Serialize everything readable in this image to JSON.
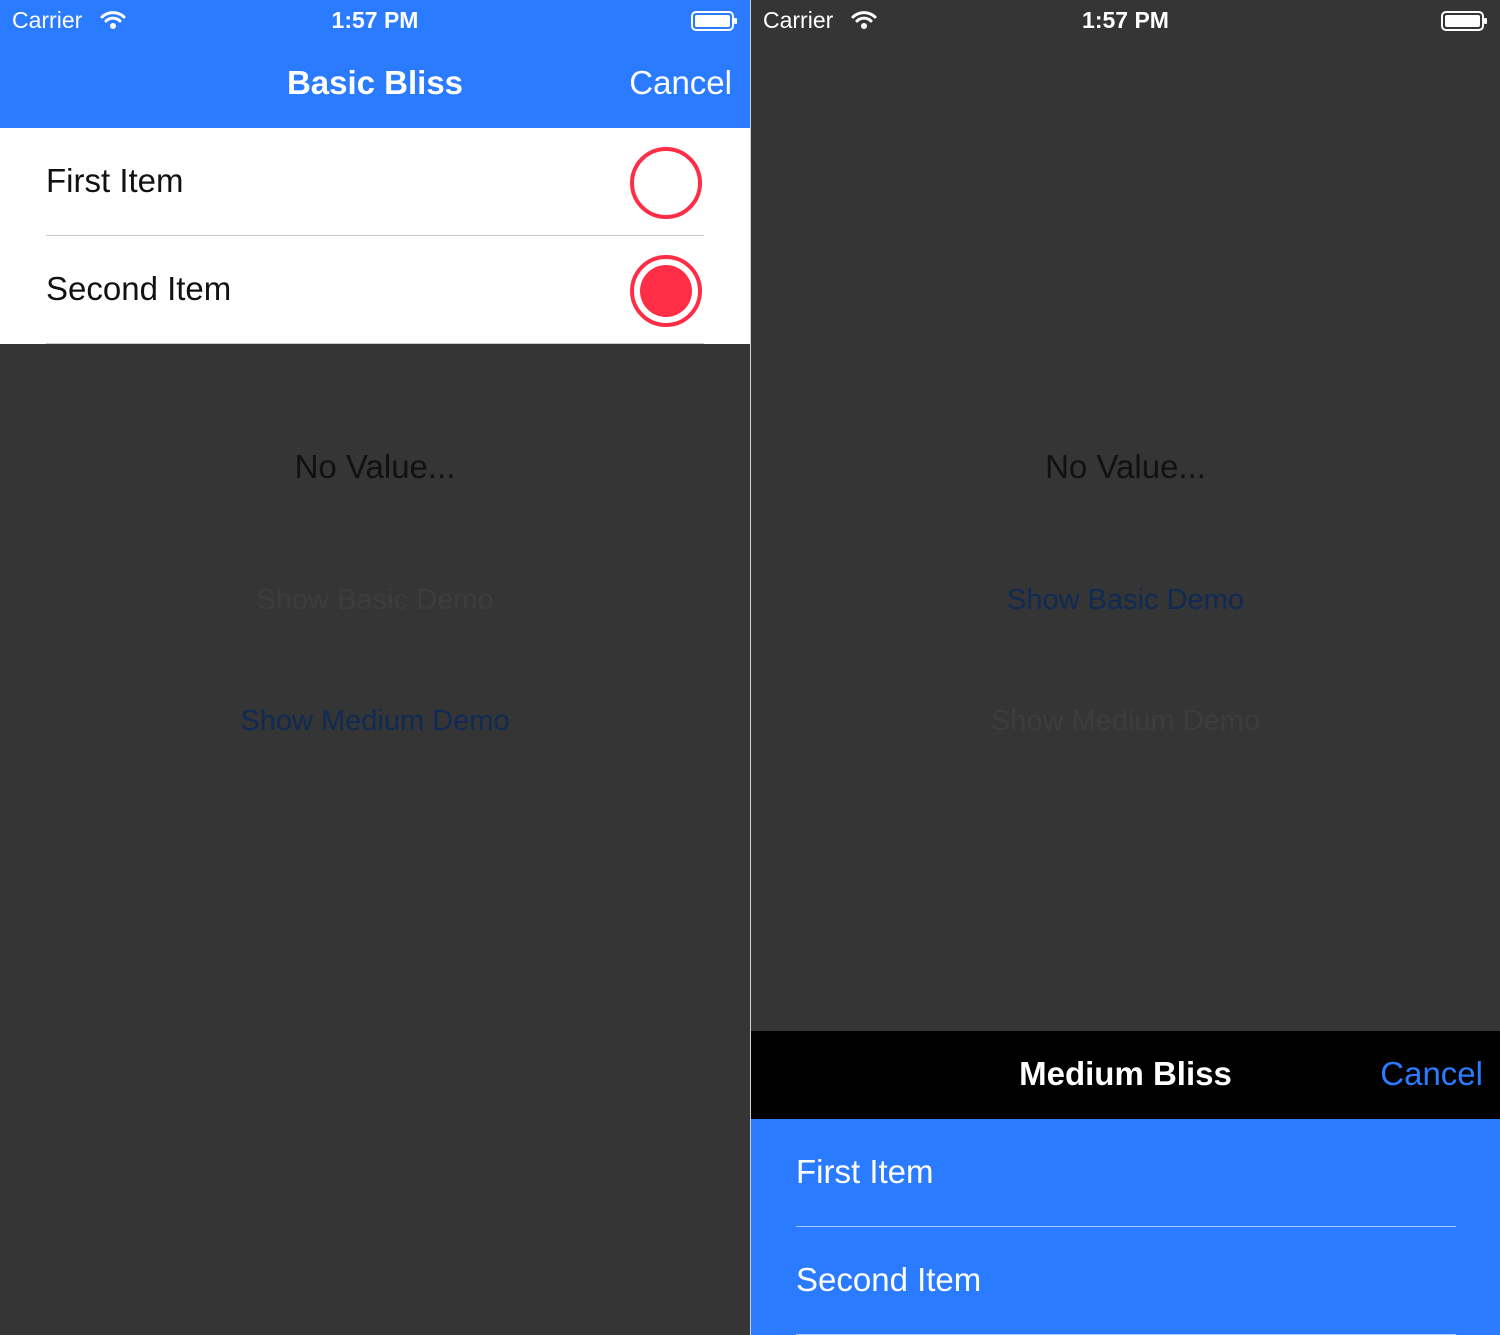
{
  "status_bar": {
    "carrier": "Carrier",
    "time": "1:57 PM"
  },
  "left": {
    "nav": {
      "title": "Basic Bliss",
      "cancel_label": "Cancel"
    },
    "items": [
      {
        "label": "First Item",
        "selected": false
      },
      {
        "label": "Second Item",
        "selected": true
      }
    ],
    "value_label": "No Value...",
    "show_basic_label": "Show Basic Demo",
    "show_medium_label": "Show Medium Demo"
  },
  "right": {
    "value_label": "No Value...",
    "show_basic_label": "Show Basic Demo",
    "show_medium_label": "Show Medium Demo",
    "sheet": {
      "title": "Medium Bliss",
      "cancel_label": "Cancel",
      "items": [
        {
          "label": "First Item"
        },
        {
          "label": "Second Item"
        }
      ]
    }
  },
  "colors": {
    "accent_blue": "#2a7bff",
    "radio_red": "#ff2d46",
    "background": "#353535"
  },
  "icons": [
    "wifi-icon",
    "battery-icon",
    "radio-empty-icon",
    "radio-selected-icon"
  ]
}
